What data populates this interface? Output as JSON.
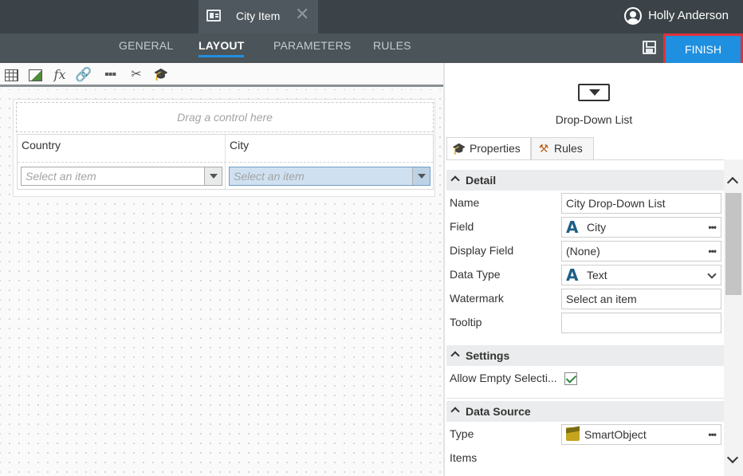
{
  "document_tab": {
    "title": "City Item",
    "icon": "form-icon",
    "close_icon": "close-icon"
  },
  "user": {
    "name": "Holly Anderson",
    "icon": "user-avatar-icon"
  },
  "nav": {
    "tabs": [
      {
        "label": "GENERAL",
        "active": false
      },
      {
        "label": "LAYOUT",
        "active": true
      },
      {
        "label": "PARAMETERS",
        "active": false
      },
      {
        "label": "RULES",
        "active": false
      }
    ],
    "save_icon": "save-icon",
    "finish_label": "FINISH",
    "finish_color": "#1f8fe0",
    "highlight_color": "#e0323a"
  },
  "toolbar": {
    "icons": [
      "table-icon",
      "table-image-icon",
      "fx-icon",
      "link-icon",
      "more-icon",
      "tools-icon",
      "cap-icon"
    ],
    "fx_label": "fx"
  },
  "canvas": {
    "drop_zone": "Drag a control here",
    "columns": [
      {
        "label": "Country",
        "placeholder": "Select an item",
        "selected": false
      },
      {
        "label": "City",
        "placeholder": "Select an item",
        "selected": true
      }
    ]
  },
  "properties": {
    "control_icon": "dropdown-list-icon",
    "control_name": "Drop-Down List",
    "tabs": [
      {
        "label": "Properties",
        "icon": "cap-icon",
        "active": true
      },
      {
        "label": "Rules",
        "icon": "gavel-icon",
        "active": false
      }
    ],
    "detail": {
      "title": "Detail",
      "rows": {
        "name": {
          "label": "Name",
          "value": "City Drop-Down List"
        },
        "field": {
          "label": "Field",
          "value": "City",
          "type_icon": "A"
        },
        "display_field": {
          "label": "Display Field",
          "value": "(None)"
        },
        "data_type": {
          "label": "Data Type",
          "value": "Text",
          "type_icon": "A"
        },
        "watermark": {
          "label": "Watermark",
          "value": "Select an item"
        },
        "tooltip": {
          "label": "Tooltip",
          "value": ""
        }
      }
    },
    "settings": {
      "title": "Settings",
      "allow_empty": {
        "label": "Allow Empty Selecti...",
        "checked": true
      }
    },
    "data_source": {
      "title": "Data Source",
      "type": {
        "label": "Type",
        "value": "SmartObject",
        "icon": "smartobject-icon"
      },
      "items": {
        "label": "Items"
      }
    },
    "ellipsis": "•••"
  }
}
